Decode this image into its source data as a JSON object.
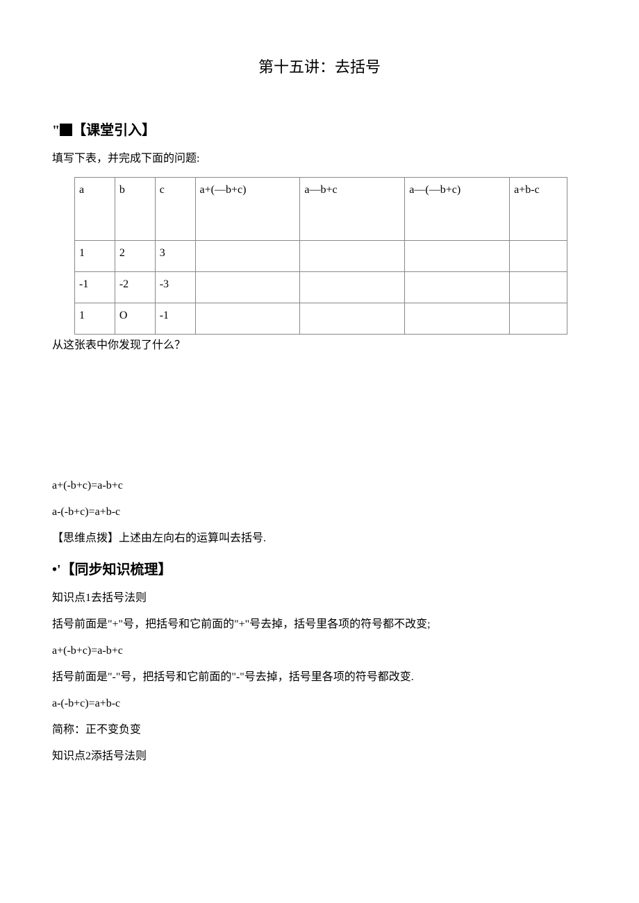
{
  "title": "第十五讲：去括号",
  "section1": {
    "heading_prefix": "\"",
    "heading": "【课堂引入】",
    "intro": "填写下表，并完成下面的问题:",
    "table": {
      "headers": [
        "a",
        "b",
        "c",
        "a+(—b+c)",
        "a—b+c",
        "a—(—b+c)",
        "a+b-c"
      ],
      "rows": [
        [
          "1",
          "2",
          "3",
          "",
          "",
          "",
          ""
        ],
        [
          "-1",
          "-2",
          "-3",
          "",
          "",
          "",
          ""
        ],
        [
          "1",
          "O",
          "-1",
          "",
          "",
          "",
          ""
        ]
      ]
    },
    "followup": "从这张表中你发现了什么？",
    "eq1": "a+(-b+c)=a-b+c",
    "eq2": "a-(-b+c)=a+b-c",
    "hint": "【思维点拨】上述由左向右的运算叫去括号."
  },
  "section2": {
    "heading_prefix": "•'",
    "heading": "【同步知识梳理】",
    "kp1_title": "知识点1去括号法则",
    "kp1_line1": "括号前面是\"+\"号，把括号和它前面的\"+\"号去掉，括号里各项的符号都不改变;",
    "kp1_eq1": "a+(-b+c)=a-b+c",
    "kp1_line2": "括号前面是\"-\"号，把括号和它前面的\"-\"号去掉，括号里各项的符号都改变.",
    "kp1_eq2": "a-(-b+c)=a+b-c",
    "kp1_short": "简称：正不变负变",
    "kp2_title": "知识点2添括号法则"
  }
}
